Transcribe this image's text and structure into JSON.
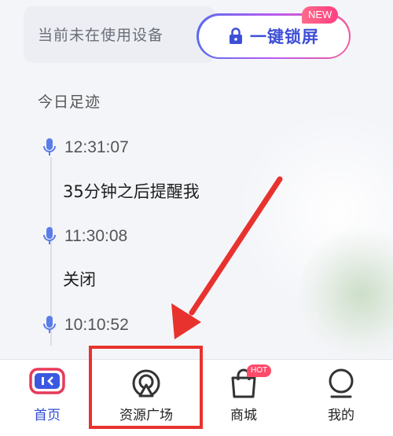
{
  "status": {
    "text": "当前未在使用设备",
    "lock_button_label": "一键锁屏",
    "new_badge": "NEW"
  },
  "footprint": {
    "title": "今日足迹",
    "entries": [
      {
        "time": "12:31:07",
        "note": "35分钟之后提醒我"
      },
      {
        "time": "11:30:08",
        "note": "关闭"
      },
      {
        "time": "10:10:52",
        "note": ""
      }
    ]
  },
  "bottom_nav": {
    "items": [
      {
        "label": "首页",
        "icon": "home-icon",
        "active": true
      },
      {
        "label": "资源广场",
        "icon": "resource-square-icon",
        "active": false
      },
      {
        "label": "商城",
        "icon": "shopping-bag-icon",
        "active": false
      },
      {
        "label": "我的",
        "icon": "profile-icon",
        "active": false
      }
    ],
    "hot_badge": "HOT"
  },
  "colors": {
    "accent": "#2f4ad6",
    "annotation_red": "#e8322e",
    "badge_pink": "#ff4a6a"
  }
}
